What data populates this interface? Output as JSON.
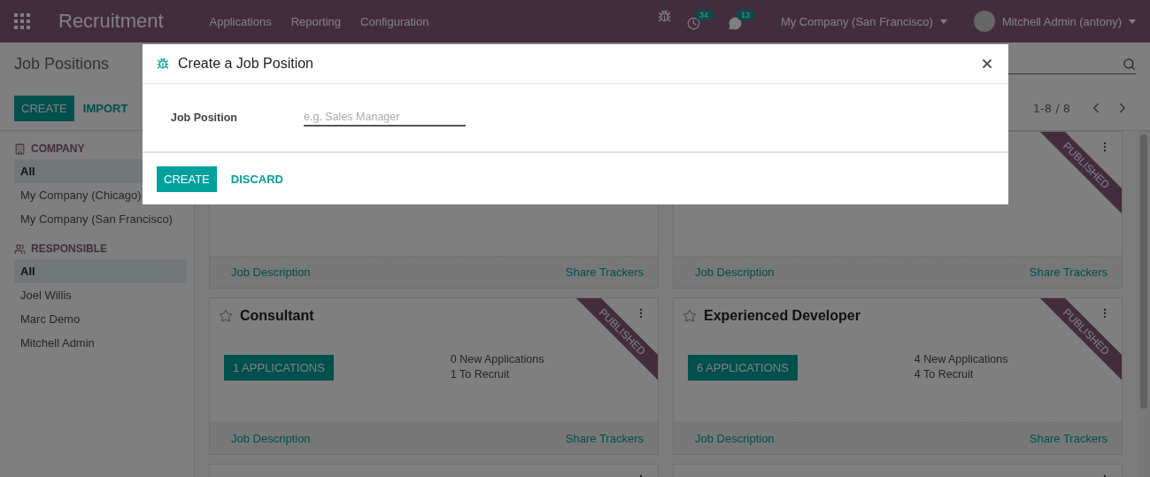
{
  "topbar": {
    "app_name": "Recruitment",
    "menu": [
      "Applications",
      "Reporting",
      "Configuration"
    ],
    "activity_count": "34",
    "message_count": "13",
    "company": "My Company (San Francisco)",
    "user": "Mitchell Admin (antony)"
  },
  "control_panel": {
    "breadcrumb": "Job Positions",
    "buttons": [
      "CREATE",
      "IMPORT"
    ],
    "pager": "1-8 / 8"
  },
  "sidebar": {
    "sections": [
      {
        "kind": "company",
        "title": "COMPANY",
        "items": [
          {
            "label": "All",
            "selected": true
          },
          {
            "label": "My Company (Chicago)",
            "selected": false
          },
          {
            "label": "My Company (San Francisco)",
            "selected": false
          }
        ]
      },
      {
        "kind": "people",
        "title": "RESPONSIBLE",
        "items": [
          {
            "label": "All",
            "selected": true
          },
          {
            "label": "Joel Willis",
            "selected": false
          },
          {
            "label": "Marc Demo",
            "selected": false
          },
          {
            "label": "Mitchell Admin",
            "selected": false
          }
        ]
      }
    ]
  },
  "cards": [
    {
      "footer_links": [
        "Job Description",
        "Share Trackers"
      ]
    },
    {
      "ribbon": "PUBLISHED",
      "footer_links": [
        "Job Description",
        "Share Trackers"
      ]
    },
    {
      "title": "Consultant",
      "favorite": false,
      "applications_button": "1 APPLICATIONS",
      "stats": [
        "0 New Applications",
        "1 To Recruit"
      ],
      "ribbon": "PUBLISHED",
      "footer_links": [
        "Job Description",
        "Share Trackers"
      ]
    },
    {
      "title": "Experienced Developer",
      "favorite": false,
      "applications_button": "6 APPLICATIONS",
      "stats": [
        "4 New Applications",
        "4 To Recruit"
      ],
      "ribbon": "PUBLISHED",
      "footer_links": [
        "Job Description",
        "Share Trackers"
      ]
    }
  ],
  "dialog": {
    "title": "Create a Job Position",
    "field_label": "Job Position",
    "placeholder": "e.g. Sales Manager",
    "buttons": [
      {
        "label": "CREATE",
        "kind": "primary"
      },
      {
        "label": "DISCARD",
        "kind": "link"
      }
    ]
  }
}
